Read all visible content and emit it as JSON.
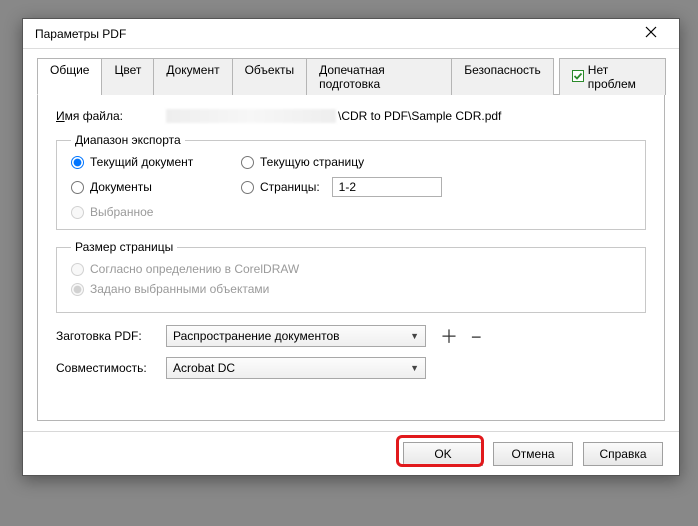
{
  "window": {
    "title": "Параметры PDF"
  },
  "tabs": {
    "general": "Общие",
    "color": "Цвет",
    "document": "Документ",
    "objects": "Объекты",
    "prepress": "Допечатная подготовка",
    "security": "Безопасность",
    "status": "Нет проблем"
  },
  "filename": {
    "label": "Имя файла:",
    "suffix": "\\CDR to PDF\\Sample CDR.pdf"
  },
  "export_range": {
    "legend": "Диапазон экспорта",
    "current_doc": "Текущий документ",
    "current_page": "Текущую страницу",
    "documents": "Документы",
    "pages": "Страницы:",
    "pages_value": "1-2",
    "selection": "Выбранное"
  },
  "page_size": {
    "legend": "Размер страницы",
    "by_coreldraw": "Согласно определению в CorelDRAW",
    "by_objects": "Задано выбранными объектами"
  },
  "preset": {
    "label": "Заготовка PDF:",
    "value": "Распространение документов"
  },
  "compat": {
    "label": "Совместимость:",
    "value": "Acrobat DC"
  },
  "buttons": {
    "ok": "OK",
    "cancel": "Отмена",
    "help": "Справка"
  }
}
